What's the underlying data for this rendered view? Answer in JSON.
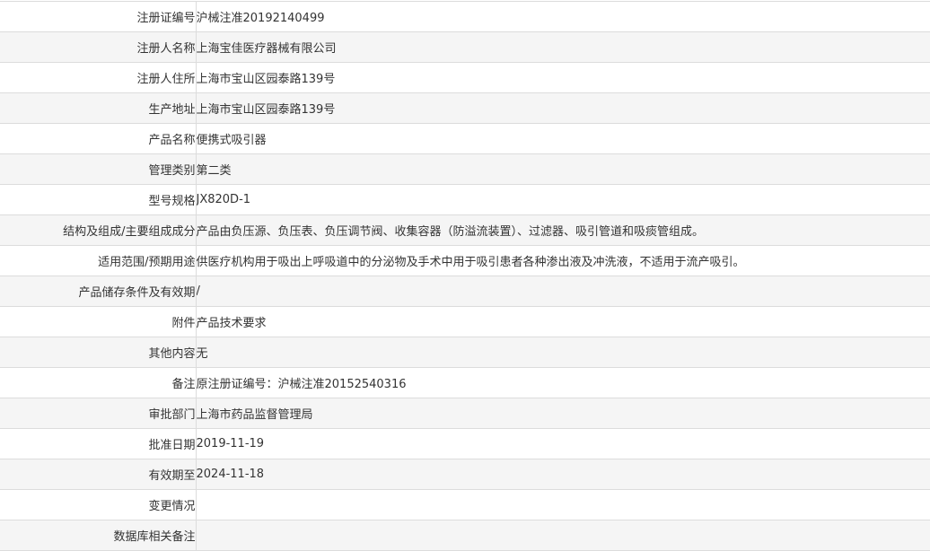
{
  "rows": [
    {
      "label": "注册证编号",
      "value": "沪械注准20192140499"
    },
    {
      "label": "注册人名称",
      "value": "上海宝佳医疗器械有限公司"
    },
    {
      "label": "注册人住所",
      "value": "上海市宝山区园泰路139号"
    },
    {
      "label": "生产地址",
      "value": "上海市宝山区园泰路139号"
    },
    {
      "label": "产品名称",
      "value": "便携式吸引器"
    },
    {
      "label": "管理类别",
      "value": "第二类"
    },
    {
      "label": "型号规格",
      "value": "JX820D-1"
    },
    {
      "label": "结构及组成/主要组成成分",
      "value": "产品由负压源、负压表、负压调节阀、收集容器（防溢流装置）、过滤器、吸引管道和吸痰管组成。"
    },
    {
      "label": "适用范围/预期用途",
      "value": "供医疗机构用于吸出上呼吸道中的分泌物及手术中用于吸引患者各种渗出液及冲洗液，不适用于流产吸引。"
    },
    {
      "label": "产品储存条件及有效期",
      "value": "/"
    },
    {
      "label": "附件",
      "value": "产品技术要求"
    },
    {
      "label": "其他内容",
      "value": "无"
    },
    {
      "label": "备注",
      "value": "原注册证编号：沪械注准20152540316"
    },
    {
      "label": "审批部门",
      "value": "上海市药品监督管理局"
    },
    {
      "label": "批准日期",
      "value": "2019-11-19"
    },
    {
      "label": "有效期至",
      "value": "2024-11-18"
    },
    {
      "label": "变更情况",
      "value": ""
    },
    {
      "label": "数据库相关备注",
      "value": ""
    }
  ]
}
